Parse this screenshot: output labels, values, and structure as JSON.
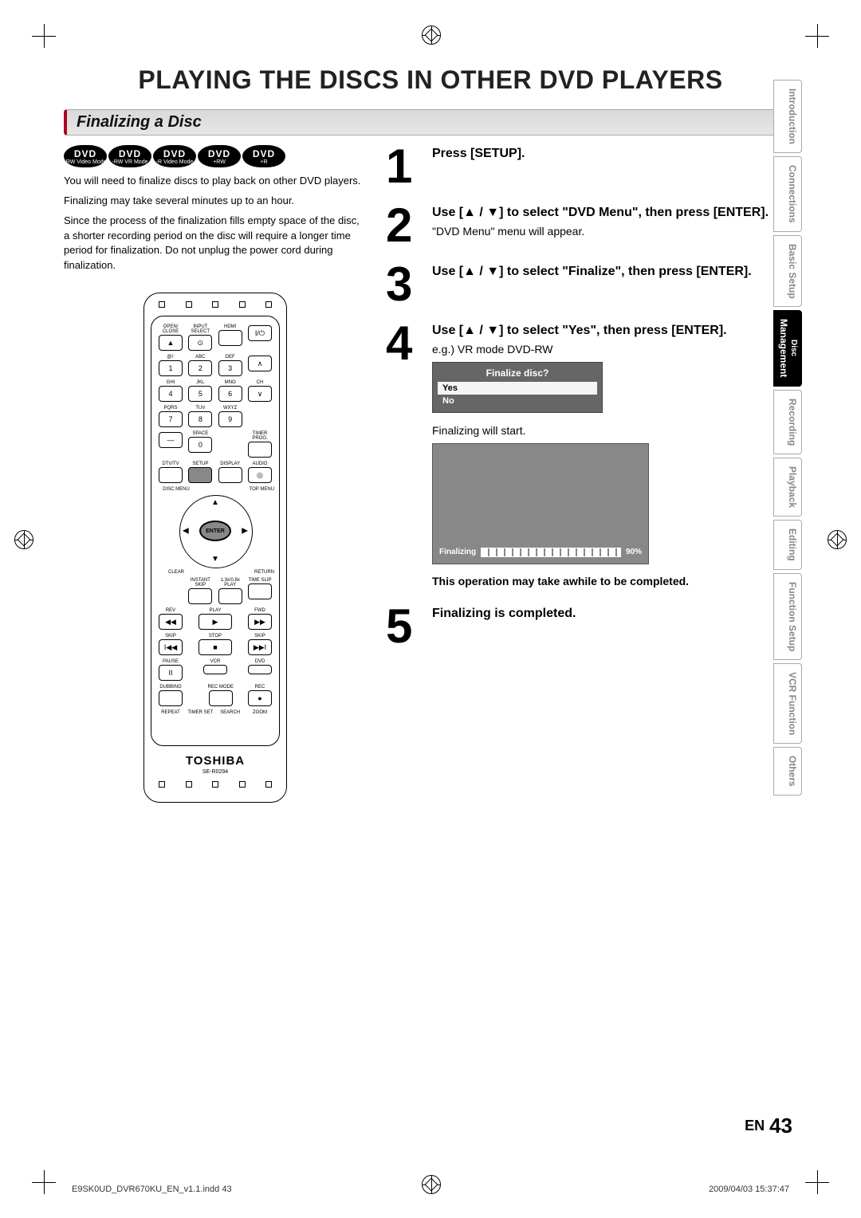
{
  "title": "PLAYING THE DISCS IN OTHER DVD PLAYERS",
  "section": {
    "heading": "Finalizing a Disc"
  },
  "badges": [
    {
      "top": "DVD",
      "bot": "-RW Video Mode"
    },
    {
      "top": "DVD",
      "bot": "-RW VR Mode"
    },
    {
      "top": "DVD",
      "bot": "-R Video Mode"
    },
    {
      "top": "DVD",
      "bot": "+RW"
    },
    {
      "top": "DVD",
      "bot": "+R"
    }
  ],
  "intro": {
    "p1": "You will need to finalize discs to play back on other DVD players.",
    "p2": "Finalizing may take several minutes up to an hour.",
    "p3": "Since the process of the finalization fills empty space of the disc, a shorter recording period on the disc will require a longer time period for finalization. Do not unplug the power cord during finalization."
  },
  "remote": {
    "row1": [
      "OPEN/\nCLOSE",
      "INPUT\nSELECT",
      "HDMI",
      ""
    ],
    "row2": [
      "@/:",
      "ABC",
      "DEF",
      ""
    ],
    "nums_a": [
      "1",
      "2",
      "3"
    ],
    "row3": [
      "GHI",
      "JKL",
      "MNO",
      "CH"
    ],
    "nums_b": [
      "4",
      "5",
      "6"
    ],
    "row4": [
      "PQRS",
      "TUV",
      "WXYZ",
      ""
    ],
    "nums_c": [
      "7",
      "8",
      "9"
    ],
    "row5": [
      "",
      "SPACE",
      "",
      "TIMER\nPROG."
    ],
    "nums_d": [
      "",
      "0",
      "",
      ""
    ],
    "row6": [
      "DTV/TV",
      "SETUP",
      "DISPLAY",
      "AUDIO"
    ],
    "row7": [
      "DISC MENU",
      "",
      "",
      "TOP MENU"
    ],
    "enter_label": "ENTER",
    "row_cr": [
      "CLEAR",
      "",
      "",
      "RETURN"
    ],
    "row8": [
      "",
      "INSTANT\nSKIP",
      "1.3x/0.8x\nPLAY",
      "TIME SLIP"
    ],
    "row9": [
      "REV",
      "PLAY",
      "FWD"
    ],
    "row10": [
      "SKIP",
      "STOP",
      "SKIP"
    ],
    "row11": [
      "PAUSE",
      "VCR",
      "DVD"
    ],
    "row12": [
      "DUBBING",
      "",
      "REC MODE",
      "REC"
    ],
    "row13": [
      "REPEAT",
      "TIMER SET",
      "SEARCH",
      "ZOOM"
    ],
    "brand": "TOSHIBA",
    "model": "SE-R0294"
  },
  "steps": {
    "s1": {
      "num": "1",
      "title": "Press [SETUP]."
    },
    "s2": {
      "num": "2",
      "title": "Use [▲ / ▼] to select \"DVD Menu\", then press [ENTER].",
      "sub": "\"DVD Menu\" menu will appear."
    },
    "s3": {
      "num": "3",
      "title": "Use [▲ / ▼] to select \"Finalize\", then press [ENTER]."
    },
    "s4": {
      "num": "4",
      "title": "Use [▲ / ▼] to select \"Yes\", then press [ENTER].",
      "sub": "e.g.) VR mode DVD-RW",
      "menu_title": "Finalize disc?",
      "menu_opt_yes": "Yes",
      "menu_opt_no": "No",
      "after": "Finalizing will start.",
      "progress_label": "Finalizing",
      "progress_pct": "90%",
      "note": "This operation may take awhile to be completed."
    },
    "s5": {
      "num": "5",
      "title": "Finalizing is completed."
    }
  },
  "tabs": [
    "Introduction",
    "Connections",
    "Basic Setup",
    "Disc Management",
    "Recording",
    "Playback",
    "Editing",
    "Function Setup",
    "VCR Function",
    "Others"
  ],
  "active_tab": "Disc Management",
  "footer": {
    "lang": "EN",
    "page": "43"
  },
  "imprint": {
    "left": "E9SK0UD_DVR670KU_EN_v1.1.indd   43",
    "right": "2009/04/03   15:37:47"
  }
}
